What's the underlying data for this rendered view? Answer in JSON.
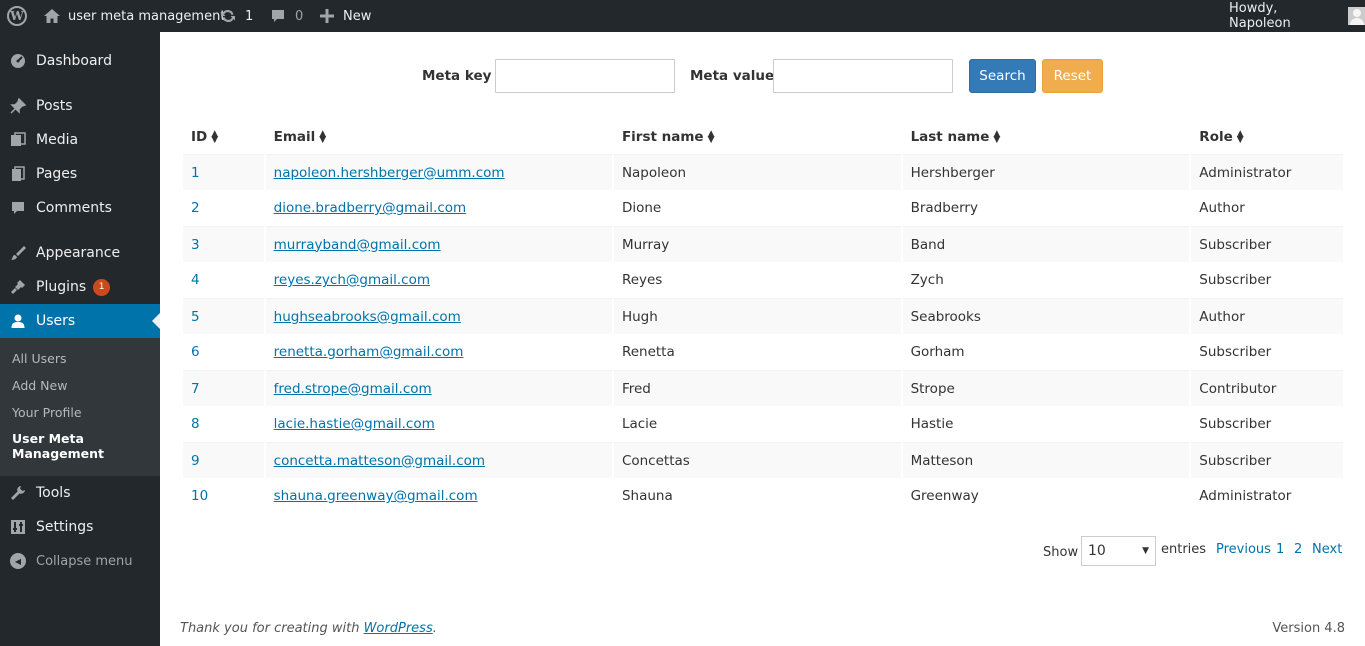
{
  "adminbar": {
    "wp_logo": "W",
    "site_name": "user meta management",
    "updates_count": "1",
    "comments_count": "0",
    "new_label": "New",
    "greeting": "Howdy, Napoleon",
    "icons": [
      "wordpress-icon",
      "home-icon",
      "refresh-icon",
      "comment-icon",
      "plus-icon",
      "avatar"
    ]
  },
  "sidebar": {
    "items": [
      {
        "label": "Dashboard",
        "icon": "dashboard-icon"
      },
      {
        "label": "Posts",
        "icon": "pin-icon"
      },
      {
        "label": "Media",
        "icon": "media-icon"
      },
      {
        "label": "Pages",
        "icon": "pages-icon"
      },
      {
        "label": "Comments",
        "icon": "comment-icon"
      },
      {
        "label": "Appearance",
        "icon": "brush-icon"
      },
      {
        "label": "Plugins",
        "icon": "plugin-icon",
        "badge": "1"
      },
      {
        "label": "Users",
        "icon": "users-icon"
      },
      {
        "label": "Tools",
        "icon": "wrench-icon"
      },
      {
        "label": "Settings",
        "icon": "settings-icon"
      }
    ],
    "submenu": [
      "All Users",
      "Add New",
      "Your Profile",
      "User Meta Management"
    ],
    "collapse_label": "Collapse menu"
  },
  "search": {
    "meta_key_label": "Meta key :",
    "meta_key_value": "",
    "meta_value_label": "Meta value :",
    "meta_value_value": "",
    "search_button": "Search",
    "reset_button": "Reset"
  },
  "table": {
    "columns": [
      "ID",
      "Email",
      "First name",
      "Last name",
      "Role"
    ],
    "rows": [
      {
        "id": "1",
        "email": "napoleon.hershberger@umm.com",
        "first": "Napoleon",
        "last": "Hershberger",
        "role": "Administrator"
      },
      {
        "id": "2",
        "email": "dione.bradberry@gmail.com",
        "first": "Dione",
        "last": "Bradberry",
        "role": "Author"
      },
      {
        "id": "3",
        "email": "murrayband@gmail.com",
        "first": "Murray",
        "last": "Band",
        "role": "Subscriber"
      },
      {
        "id": "4",
        "email": "reyes.zych@gmail.com",
        "first": "Reyes",
        "last": "Zych",
        "role": "Subscriber"
      },
      {
        "id": "5",
        "email": "hughseabrooks@gmail.com",
        "first": "Hugh",
        "last": "Seabrooks",
        "role": "Author"
      },
      {
        "id": "6",
        "email": "renetta.gorham@gmail.com",
        "first": "Renetta",
        "last": "Gorham",
        "role": "Subscriber"
      },
      {
        "id": "7",
        "email": "fred.strope@gmail.com",
        "first": "Fred",
        "last": "Strope",
        "role": "Contributor"
      },
      {
        "id": "8",
        "email": "lacie.hastie@gmail.com",
        "first": "Lacie",
        "last": "Hastie",
        "role": "Subscriber"
      },
      {
        "id": "9",
        "email": "concetta.matteson@gmail.com",
        "first": "Concettas",
        "last": "Matteson",
        "role": "Subscriber"
      },
      {
        "id": "10",
        "email": "shauna.greenway@gmail.com",
        "first": "Shauna",
        "last": "Greenway",
        "role": "Administrator"
      }
    ]
  },
  "pagination": {
    "show_label": "Show",
    "entries_value": "10",
    "entries_label": "entries",
    "previous": "Previous",
    "pages": [
      "1",
      "2"
    ],
    "next": "Next"
  },
  "footer": {
    "thanks_prefix": "Thank you for creating with ",
    "thanks_link": "WordPress",
    "thanks_suffix": ".",
    "version": "Version 4.8"
  },
  "colors": {
    "adminbar_bg": "#23282d",
    "accent": "#0073aa",
    "search_button": "#337ab7",
    "reset_button": "#f0ad4e",
    "badge": "#ca4a1f"
  }
}
